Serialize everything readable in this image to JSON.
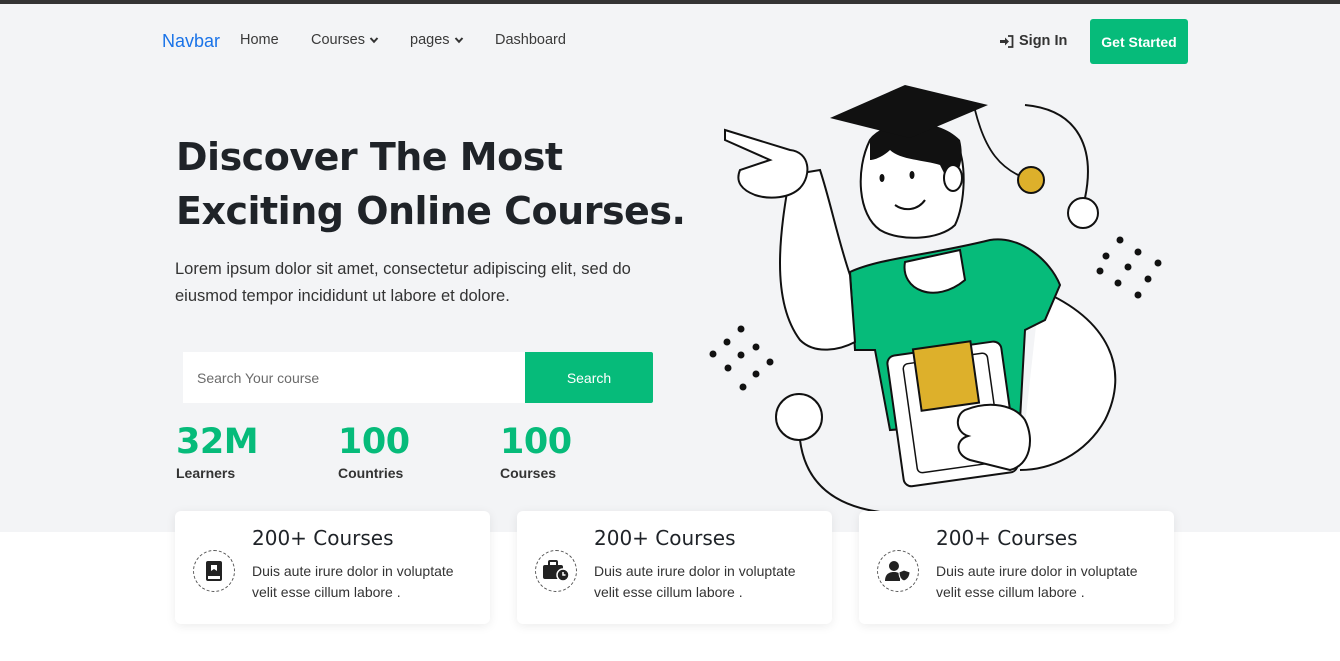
{
  "nav": {
    "brand": "Navbar",
    "links": [
      {
        "label": "Home"
      },
      {
        "label": "Courses",
        "dropdown": true
      },
      {
        "label": "pages",
        "dropdown": true
      },
      {
        "label": "Dashboard"
      }
    ],
    "sign_in": "Sign In",
    "get_started": "Get Started"
  },
  "hero": {
    "title_line1": "Discover The Most",
    "title_line2": "Exciting Online Courses.",
    "description": "Lorem ipsum dolor sit amet, consectetur adipiscing elit, sed do eiusmod tempor incididunt ut labore et dolore.",
    "search_placeholder": "Search Your course",
    "search_button": "Search"
  },
  "stats": [
    {
      "value": "32M",
      "label": "Learners"
    },
    {
      "value": "100",
      "label": "Countries"
    },
    {
      "value": "100",
      "label": "Courses"
    }
  ],
  "features": [
    {
      "icon": "book-icon",
      "title": "200+ Courses",
      "text": "Duis aute irure dolor in voluptate velit esse cillum labore ."
    },
    {
      "icon": "briefcase-clock-icon",
      "title": "200+ Courses",
      "text": "Duis aute irure dolor in voluptate velit esse cillum labore ."
    },
    {
      "icon": "user-shield-icon",
      "title": "200+ Courses",
      "text": "Duis aute irure dolor in voluptate velit esse cillum labore ."
    }
  ],
  "colors": {
    "accent": "#06bb7a",
    "brand": "#1a73e8",
    "heading": "#1f2328",
    "hero_background": "#f3f4f6",
    "illustration_yellow": "#ddb02b"
  }
}
